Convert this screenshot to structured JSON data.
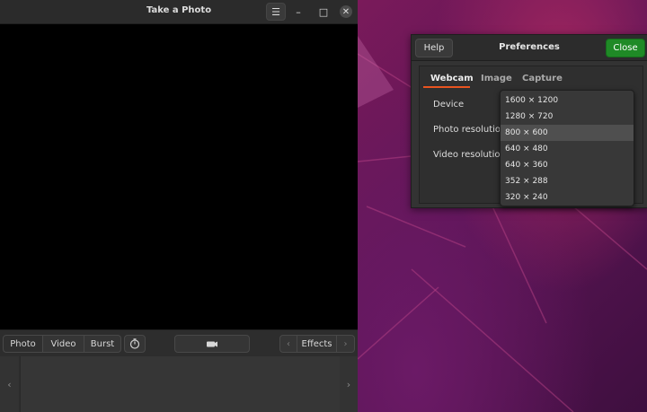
{
  "window": {
    "title": "Take a Photo",
    "menu_icon": "hamburger-icon",
    "minimize_icon": "minimize-icon",
    "maximize_icon": "maximize-icon",
    "close_icon": "close-icon"
  },
  "toolbar": {
    "modes": [
      "Photo",
      "Video",
      "Burst"
    ],
    "active_mode": "Photo",
    "effects_label": "Effects"
  },
  "preferences": {
    "help_label": "Help",
    "title": "Preferences",
    "close_label": "Close",
    "tabs": [
      "Webcam",
      "Image",
      "Capture"
    ],
    "active_tab": "Webcam",
    "labels": {
      "device": "Device",
      "photo_resolution": "Photo resolution",
      "video_resolution": "Video resolution"
    }
  },
  "resolution_menu": {
    "options": [
      "1600 × 1200",
      "1280 × 720",
      "800 × 600",
      "640 × 480",
      "640 × 360",
      "352 × 288",
      "320 × 240"
    ],
    "highlighted": "800 × 600"
  },
  "colors": {
    "accent": "#e95420",
    "close_button": "#1f8a26"
  }
}
